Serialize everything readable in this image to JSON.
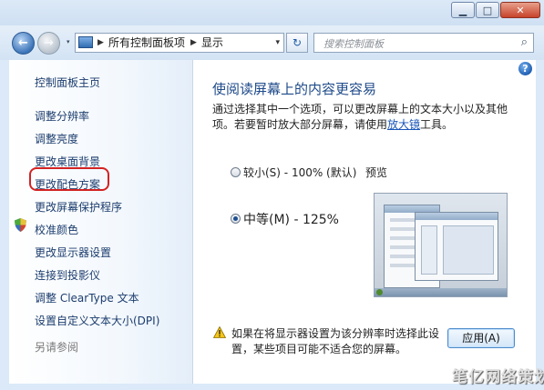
{
  "window": {
    "minimize_label": "▁",
    "maximize_label": "□",
    "close_label": "✕"
  },
  "nav": {
    "back_label": "←",
    "forward_label": "→",
    "dropdown_label": "▾"
  },
  "address": {
    "crumbs": [
      "所有控制面板项",
      "显示"
    ],
    "separator": "▶",
    "refresh_label": "↻",
    "dropdown": "▾"
  },
  "search": {
    "placeholder": "搜索控制面板",
    "icon": "search-icon"
  },
  "sidebar": {
    "items": [
      {
        "label": "控制面板主页"
      },
      {
        "label": "调整分辨率"
      },
      {
        "label": "调整亮度"
      },
      {
        "label": "更改桌面背景"
      },
      {
        "label": "更改配色方案"
      },
      {
        "label": "更改屏幕保护程序"
      },
      {
        "label": "校准颜色"
      },
      {
        "label": "更改显示器设置"
      },
      {
        "label": "连接到投影仪"
      },
      {
        "label": "调整 ClearType 文本"
      },
      {
        "label": "设置自定义文本大小(DPI)"
      }
    ],
    "see_also": "另请参阅"
  },
  "main": {
    "help_label": "?",
    "heading": "使阅读屏幕上的内容更容易",
    "description_prefix": "通过选择其中一个选项，可以更改屏幕上的文本大小以及其他项。若要暂时放大部分屏幕，请使用",
    "description_link": "放大镜",
    "description_suffix": "工具。",
    "options": [
      {
        "label": "较小(S) - 100% (默认)",
        "selected": false
      },
      {
        "label": "中等(M) - 125%",
        "selected": true
      }
    ],
    "preview_label": "预览",
    "warning": "如果在将显示器设置为该分辨率时选择此设置，某些项目可能不适合您的屏幕。",
    "apply_label": "应用(A)"
  },
  "watermark": "笔亿网络策划",
  "colors": {
    "highlight": "#d32222",
    "link": "#1a56b8",
    "heading": "#1e4a8a"
  }
}
